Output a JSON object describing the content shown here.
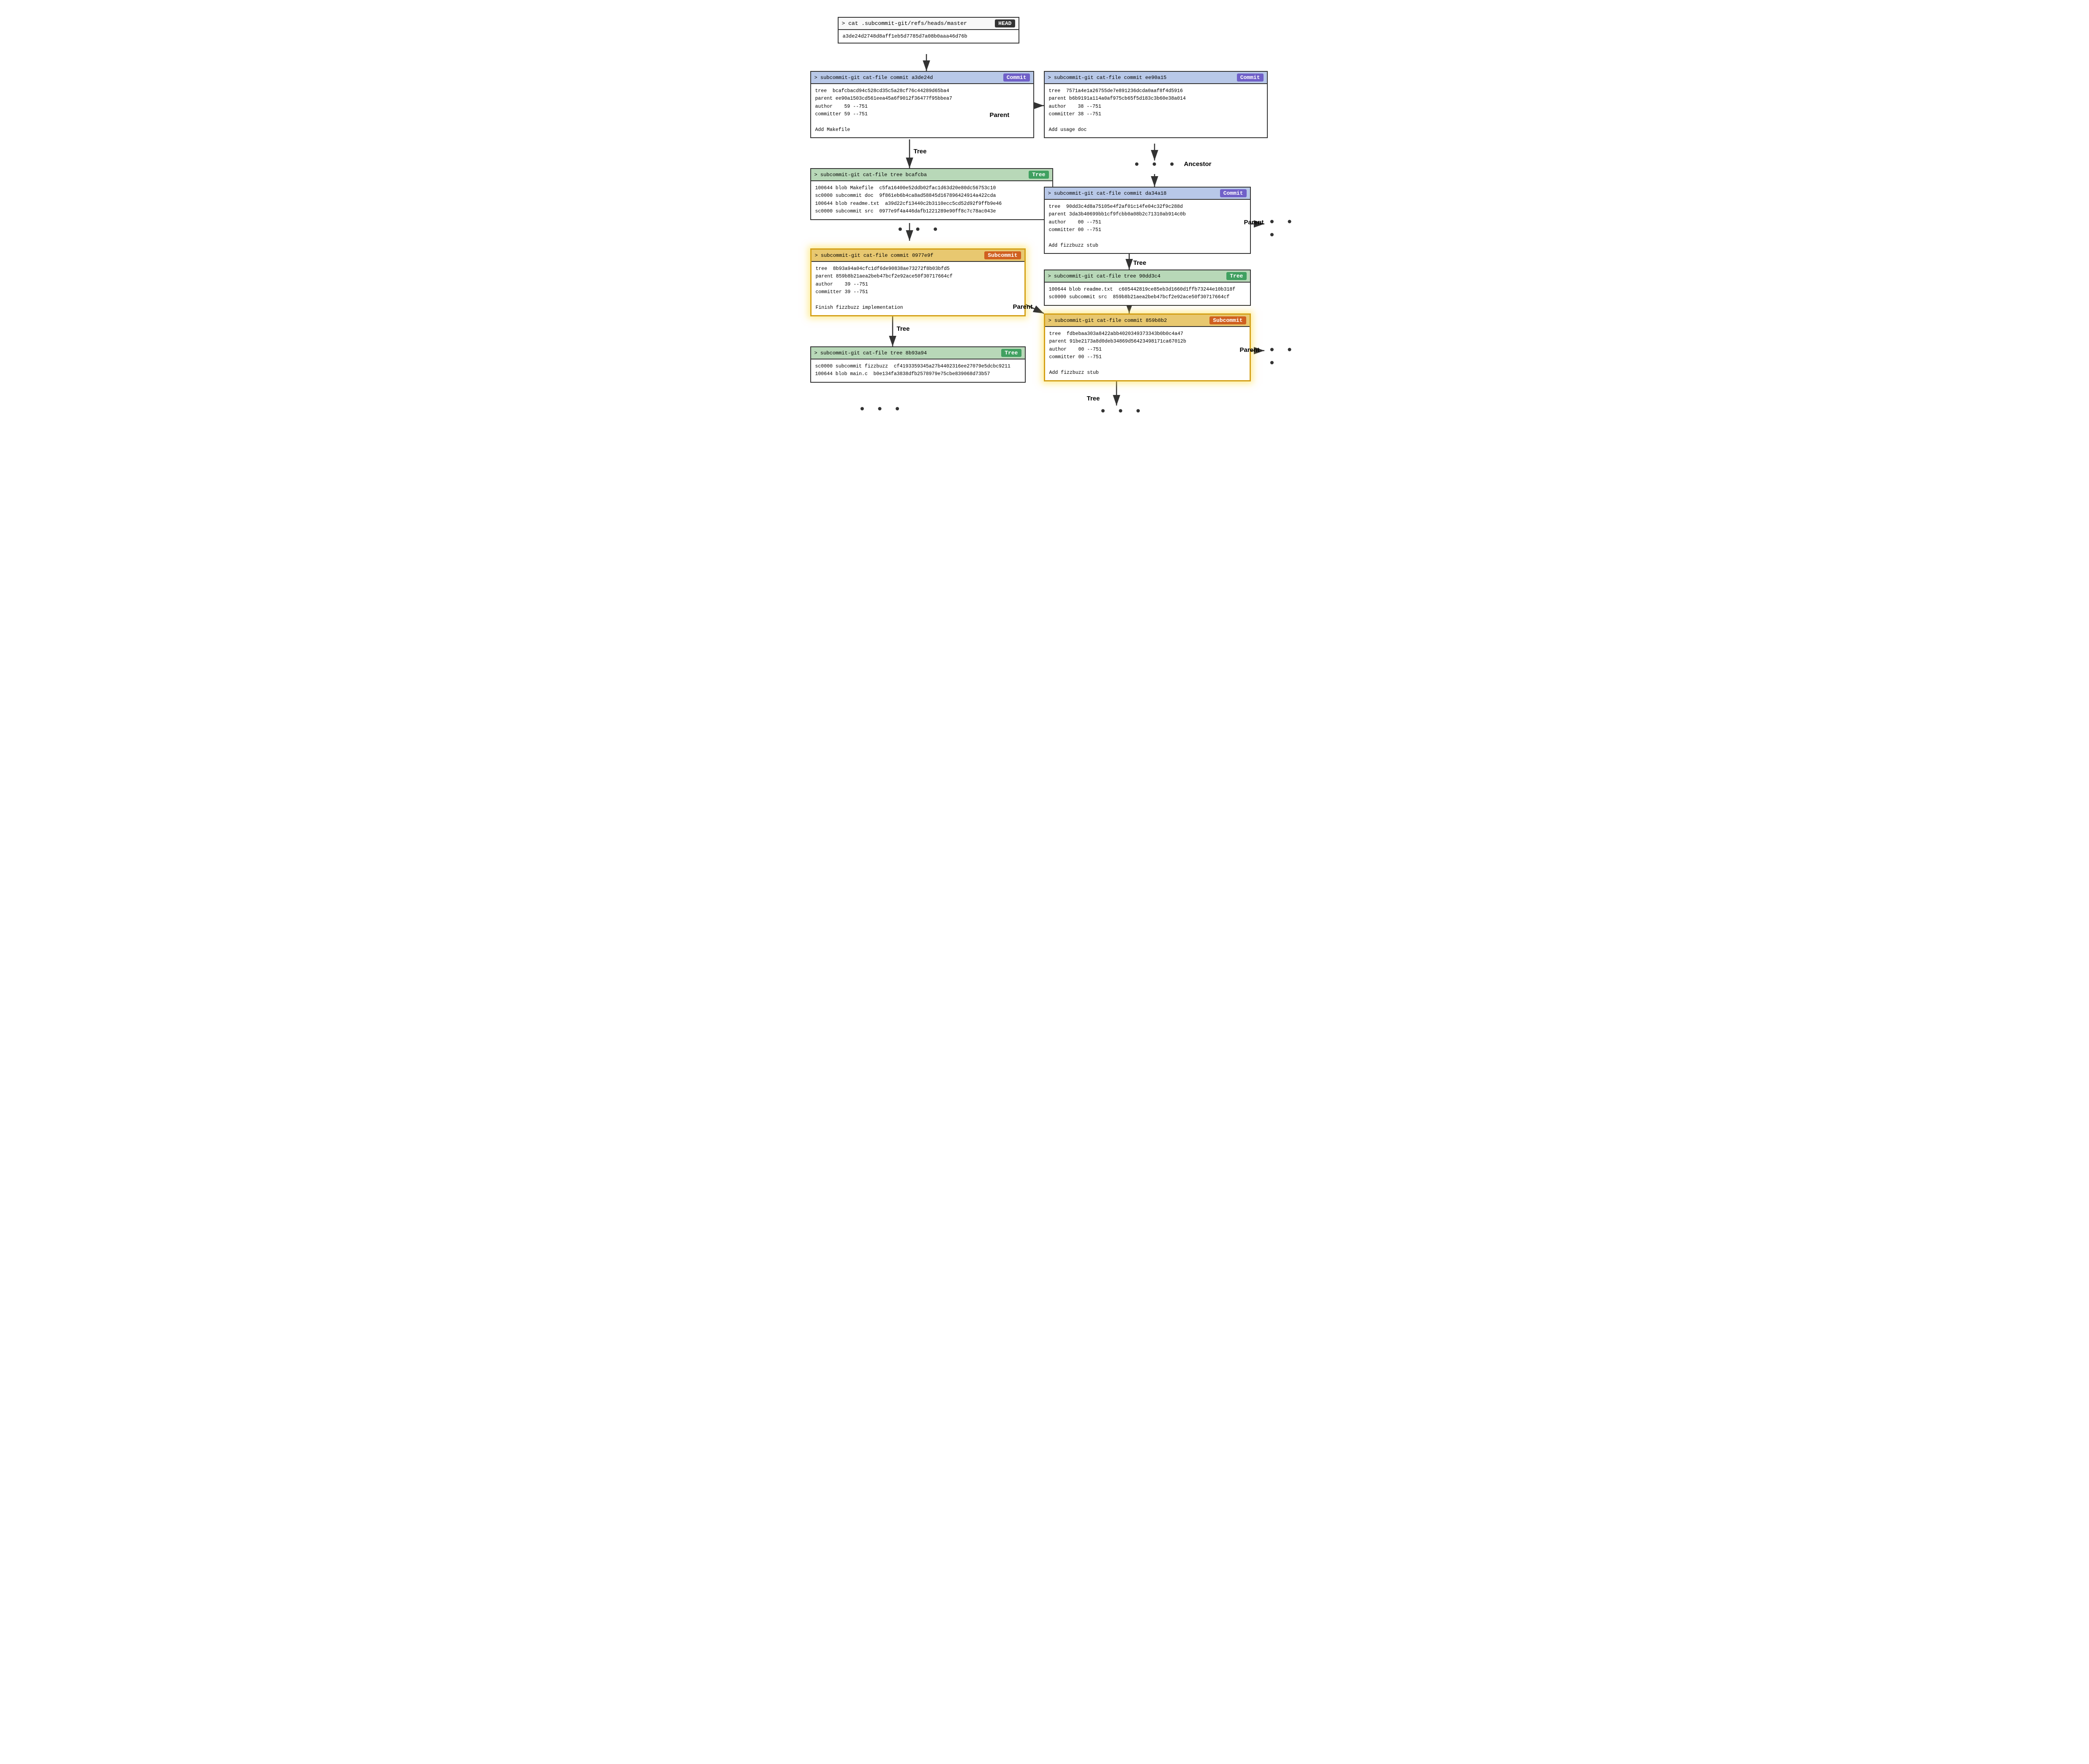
{
  "head_box": {
    "command": "> cat .subcommit-git/refs/heads/master",
    "badge": "HEAD",
    "hash": "a3de24d2748d8aff1eb5d7785d7a08b0aaa46d76b"
  },
  "commit_a3de24d": {
    "command": "> subcommit-git cat-file commit a3de24d",
    "badge": "Commit",
    "body": "tree  bcafcbacd94c528cd35c5a28cf76c44289d65ba4\nparent ee90a1503cd561eea45a6f9012f36477f95bbea7\nauthor    59 --751\ncommitter 59 --751\n\nAdd Makefile"
  },
  "commit_ee90a15": {
    "command": "> subcommit-git cat-file commit ee90a15",
    "badge": "Commit",
    "body": "tree  7571a4e1a26755de7e891236dcda0aaf8f4d5916\nparent b6b9191a114a0af975cb65f5d183c3b60e38a014\nauthor    38 --751\ncommitter 38 --751\n\nAdd usage doc"
  },
  "tree_bcafcba": {
    "command": "> subcommit-git cat-file tree bcafcba",
    "badge": "Tree",
    "body": "100644 blob Makefile  c5fa16400e52ddb02fac1d63d20e80dc56753c10\nsc0000 subcommit doc  9f861eb6b4ca8ad58845d167896424914a422cda\n100644 blob readme.txt  a39d22cf13440c2b3110ecc5cd52d92f9ffb9e46\nsc0000 subcommit src  0977e9f4a446dafb1221289e90ff8c7c78ac043e"
  },
  "commit_da34a18": {
    "command": "> subcommit-git cat-file commit da34a18",
    "badge": "Commit",
    "body": "tree  90dd3c4d8a75105e4f2af01c14fe04c32f9c288d\nparent 3da3b40699bb1cf9fcbb0a08b2c71310ab914c0b\nauthor    00 --751\ncommitter 00 --751\n\nAdd fizzbuzz stub"
  },
  "commit_0977e9f": {
    "command": "> subcommit-git cat-file commit 0977e9f",
    "badge": "Subcommit",
    "body": "tree  8b93a94a04cfc1df6de90838ae73272f8b03bfd5\nparent 859b8b21aea2beb47bcf2e92ace50f30717664cf\nauthor    39 --751\ncommitter 39 --751\n\nFinish fizzbuzz implementation"
  },
  "tree_90dd3c4": {
    "command": "> subcommit-git cat-file tree 90dd3c4",
    "badge": "Tree",
    "body": "100644 blob readme.txt  c605442819ce85eb3d1660d1ffb73244e10b318f\nsc0000 subcommit src  859b8b21aea2beb47bcf2e92ace50f30717664cf"
  },
  "commit_859b8b2": {
    "command": "> subcommit-git cat-file commit 859b8b2",
    "badge": "Subcommit",
    "body": "tree  fdbebaa303a8422abb4020349373343b0b0c4a47\nparent 91be2173a8d0deb34869d56423498171ca67012b\nauthor    00 --751\ncommitter 00 --751\n\nAdd fizzbuzz stub"
  },
  "tree_8b93a94": {
    "command": "> subcommit-git cat-file tree 8b93a94",
    "badge": "Tree",
    "body": "sc0000 subcommit fizzbuzz  cf4193359345a27b4402316ee27079e5dcbc9211\n100644 blob main.c  b0e134fa3838dfb2578979e75cbe839068d73b57"
  },
  "labels": {
    "head": "HEAD",
    "commit": "Commit",
    "tree": "Tree",
    "subcommit": "Subcommit",
    "parent": "Parent",
    "ancestor": "Ancestor"
  }
}
